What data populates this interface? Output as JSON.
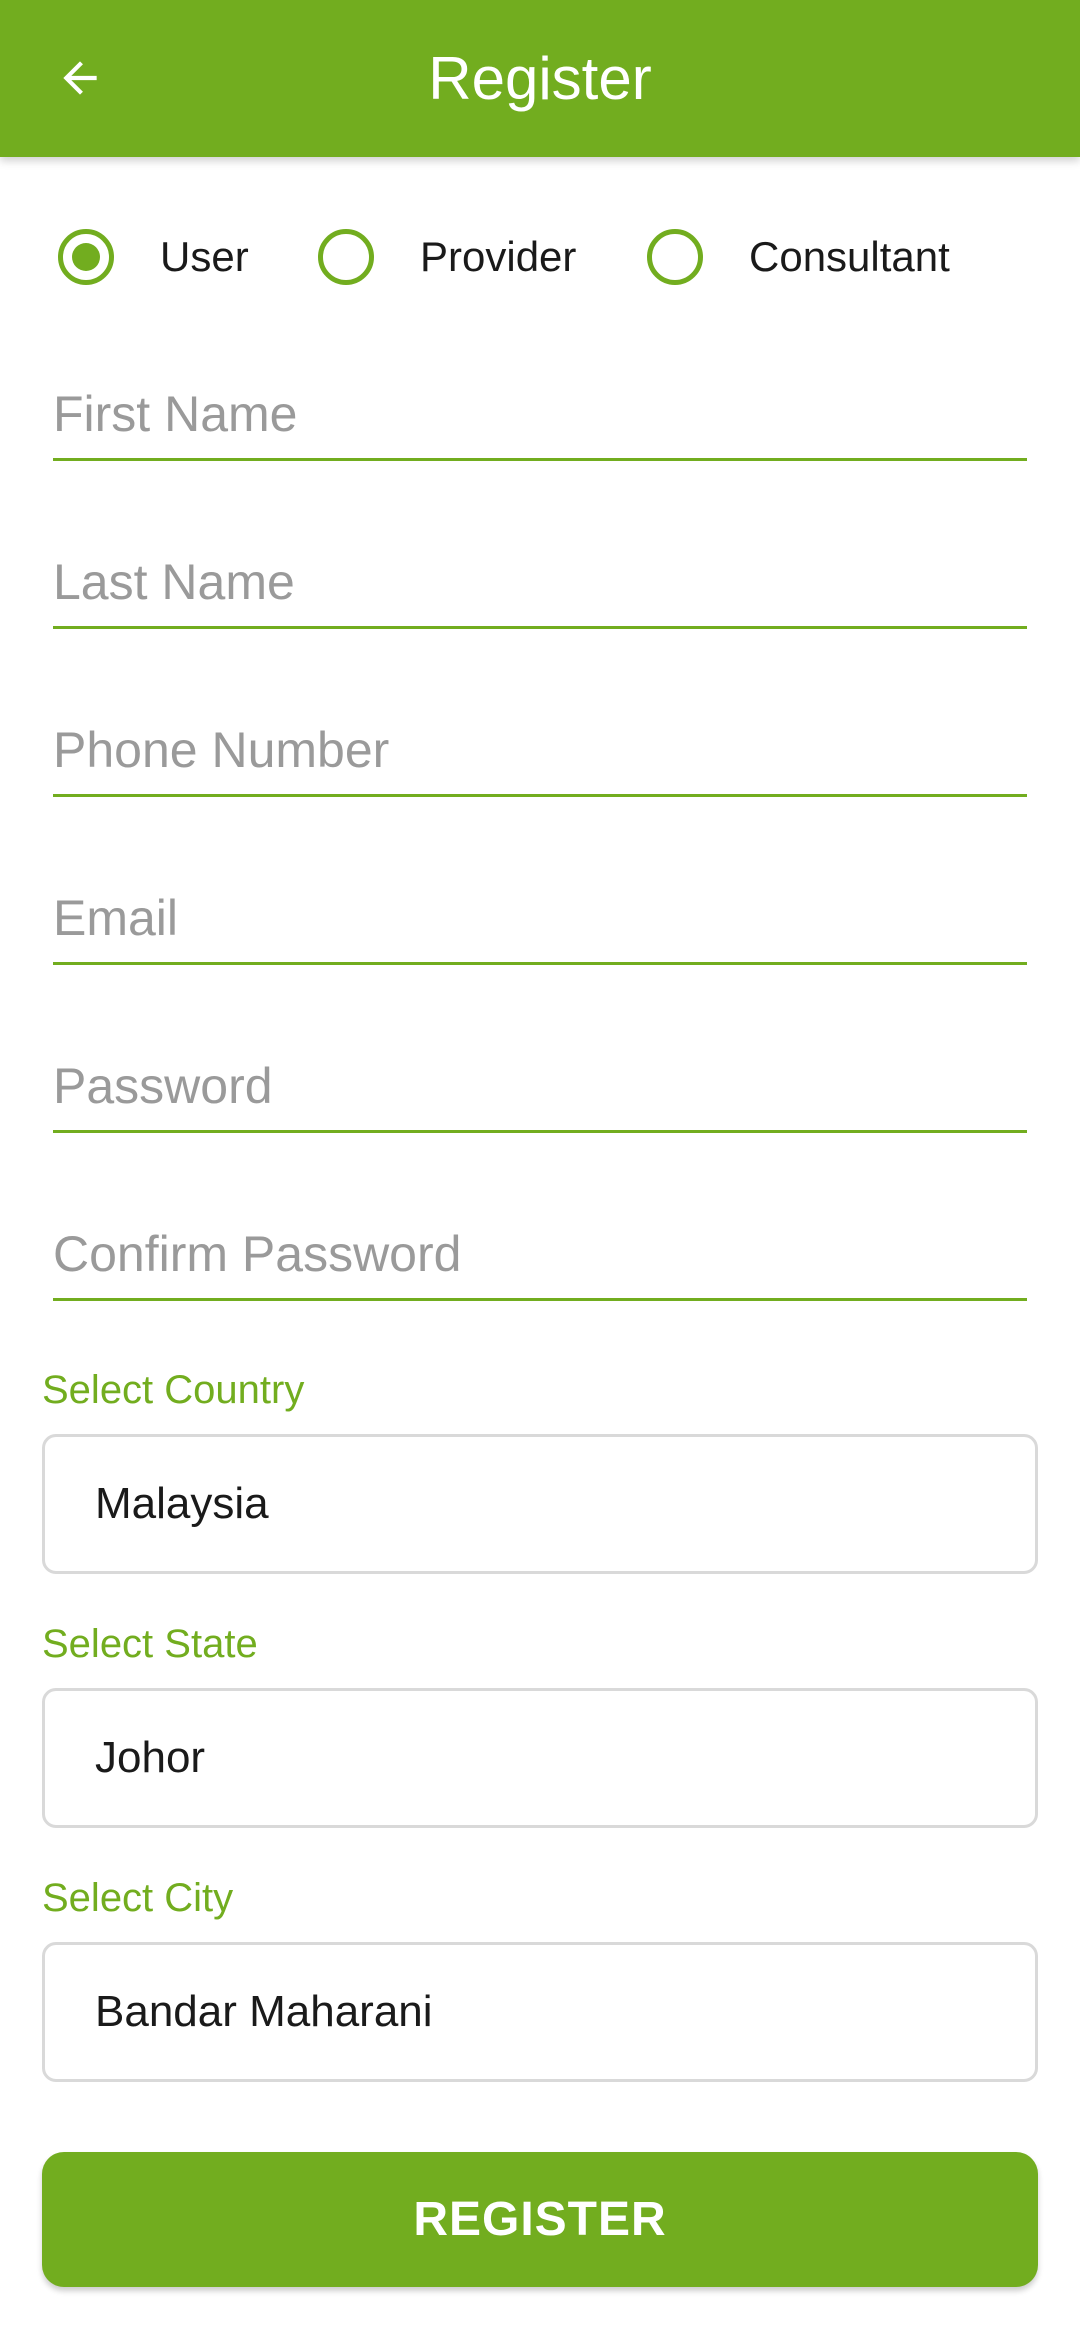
{
  "appbar": {
    "title": "Register",
    "back_icon": "arrow-left-icon",
    "color": "#72ad1f"
  },
  "account_types": [
    {
      "label": "User",
      "selected": true
    },
    {
      "label": "Provider",
      "selected": false
    },
    {
      "label": "Consultant",
      "selected": false
    }
  ],
  "form": {
    "first_name": {
      "placeholder": "First Name",
      "value": ""
    },
    "last_name": {
      "placeholder": "Last Name",
      "value": ""
    },
    "phone": {
      "placeholder": "Phone Number",
      "value": ""
    },
    "email": {
      "placeholder": "Email",
      "value": ""
    },
    "password": {
      "placeholder": "Password",
      "value": ""
    },
    "confirm_password": {
      "placeholder": "Confirm Password",
      "value": ""
    }
  },
  "location": {
    "country_label": "Select Country",
    "country_value": "Malaysia",
    "state_label": "Select State",
    "state_value": "Johor",
    "city_label": "Select City",
    "city_value": "Bandar Maharani"
  },
  "register_label": "REGISTER"
}
